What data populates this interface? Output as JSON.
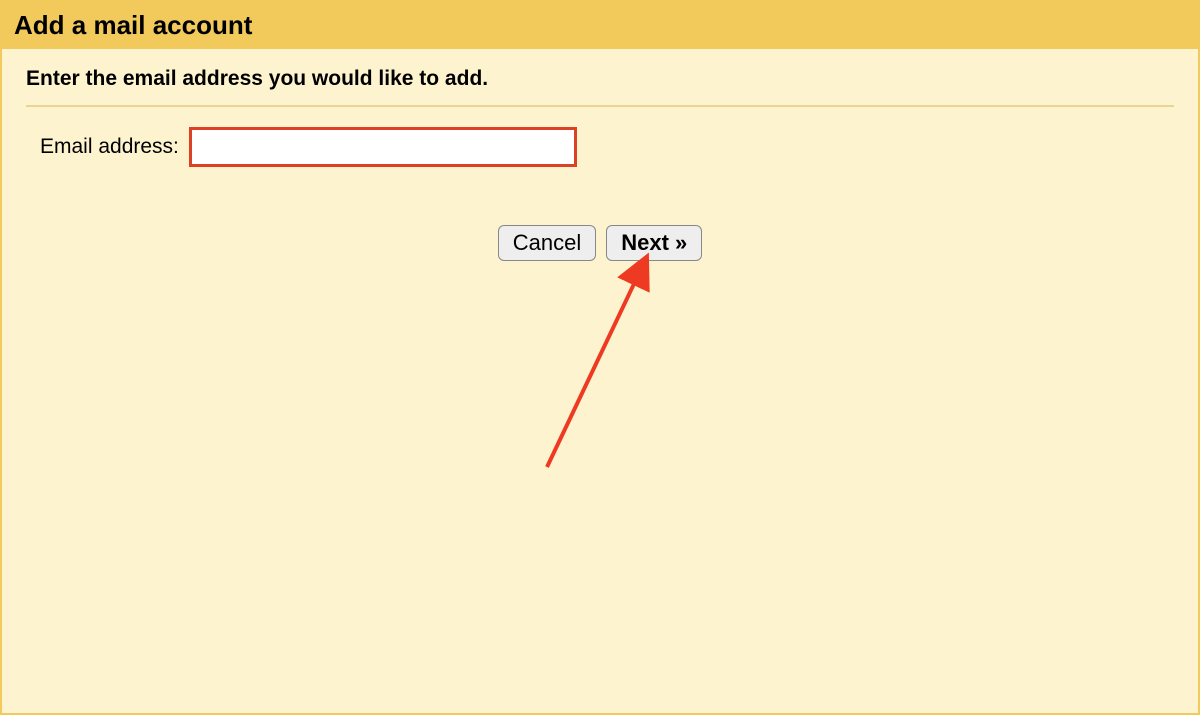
{
  "header": {
    "title": "Add a mail account"
  },
  "main": {
    "instruction": "Enter the email address you would like to add.",
    "email_label": "Email address:",
    "email_value": ""
  },
  "buttons": {
    "cancel_label": "Cancel",
    "next_label": "Next »"
  },
  "annotation": {
    "arrow_color": "#ef3a23"
  }
}
